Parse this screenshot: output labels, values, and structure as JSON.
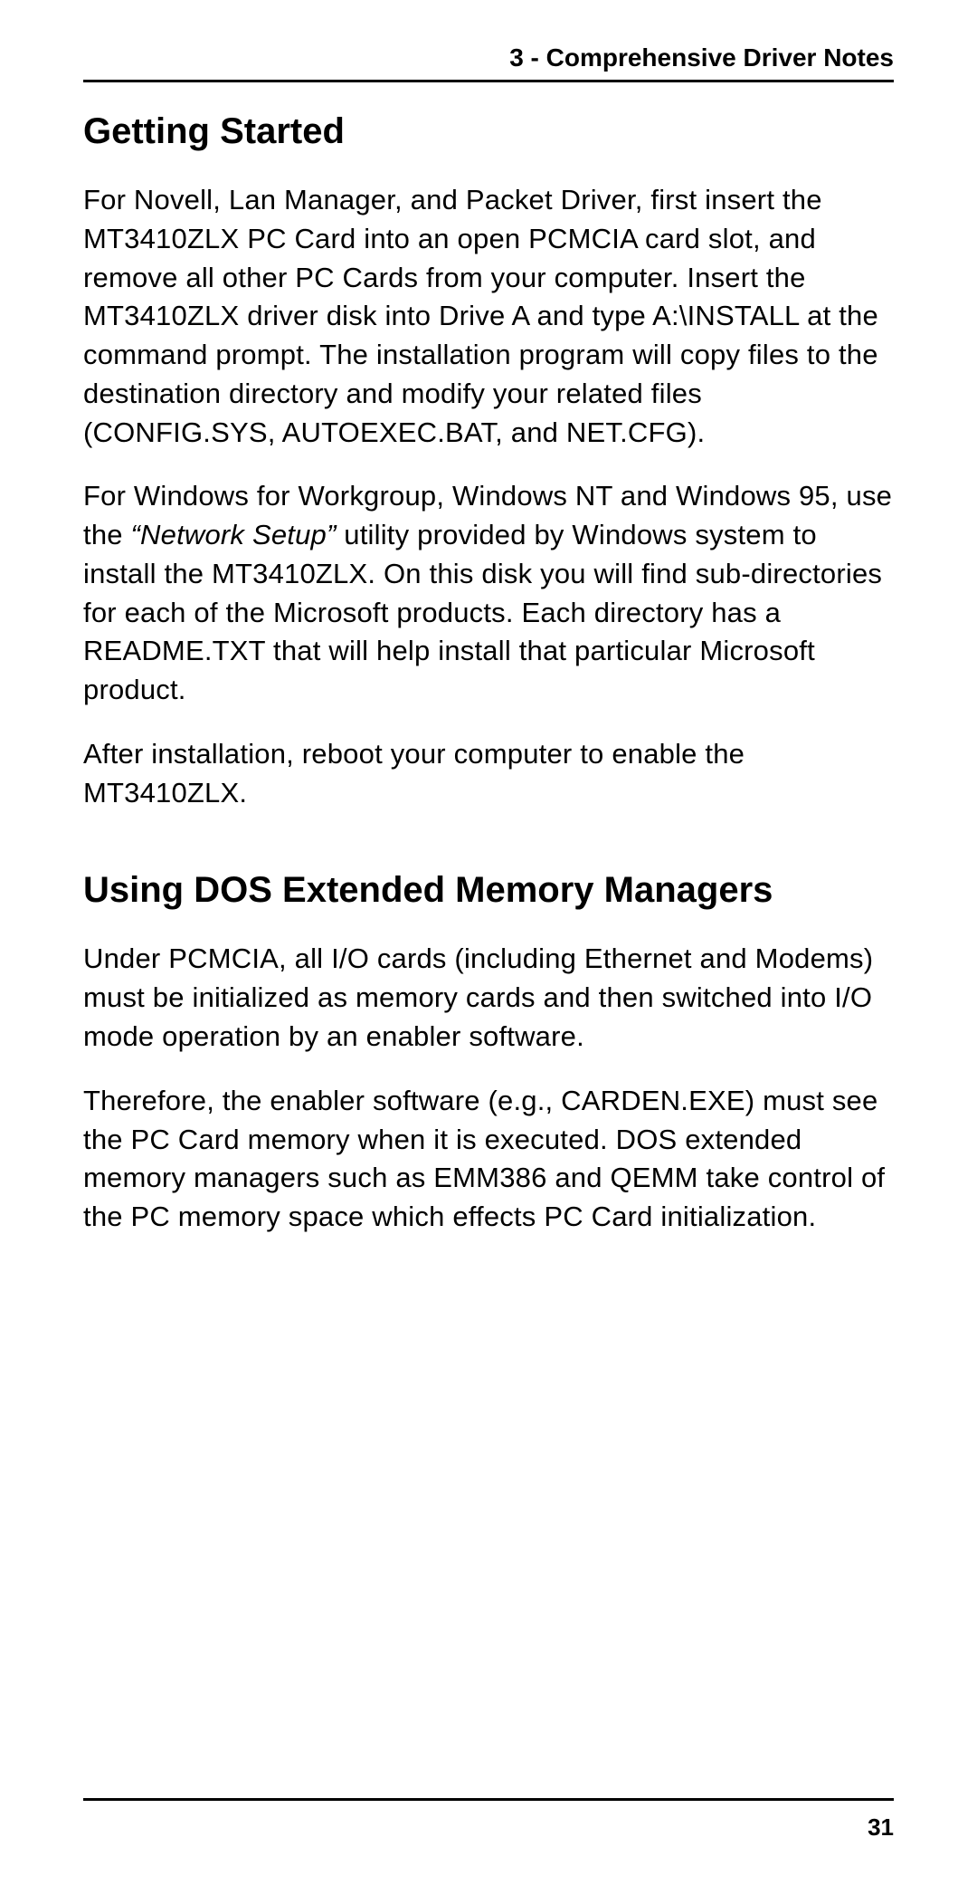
{
  "header": {
    "chapter_label": "3 - Comprehensive Driver Notes"
  },
  "section1": {
    "heading": "Getting Started",
    "para1": "For Novell, Lan Manager, and Packet Driver, first insert the MT3410ZLX PC Card into an open PCMCIA card slot, and remove all other PC Cards from your computer.  Insert the MT3410ZLX driver disk into Drive A and type A:\\INSTALL at the command prompt.  The installation program will copy files to the destination directory and modify your related files (CONFIG.SYS,  AUTOEXEC.BAT, and  NET.CFG).",
    "para2_pre": "For Windows for Workgroup, Windows NT and Windows 95, use the ",
    "para2_italic": "“Network Setup”",
    "para2_post": " utility provided by Windows system to install the MT3410ZLX.  On this disk you will find sub-directories for each of the Microsoft products.  Each directory has a README.TXT that will help install that particular Microsoft product.",
    "para3": "After installation, reboot your computer to enable the MT3410ZLX."
  },
  "section2": {
    "heading": "Using DOS Extended Memory Managers",
    "para1": "Under PCMCIA, all I/O cards (including Ethernet and Modems) must be initialized as memory cards and then switched into I/O mode operation by an enabler software.",
    "para2": "Therefore, the enabler software (e.g., CARDEN.EXE) must see the PC Card memory when it is executed.  DOS extended memory managers such as EMM386 and QEMM take control of the PC memory space which effects PC Card initialization."
  },
  "footer": {
    "page_number": "31"
  }
}
